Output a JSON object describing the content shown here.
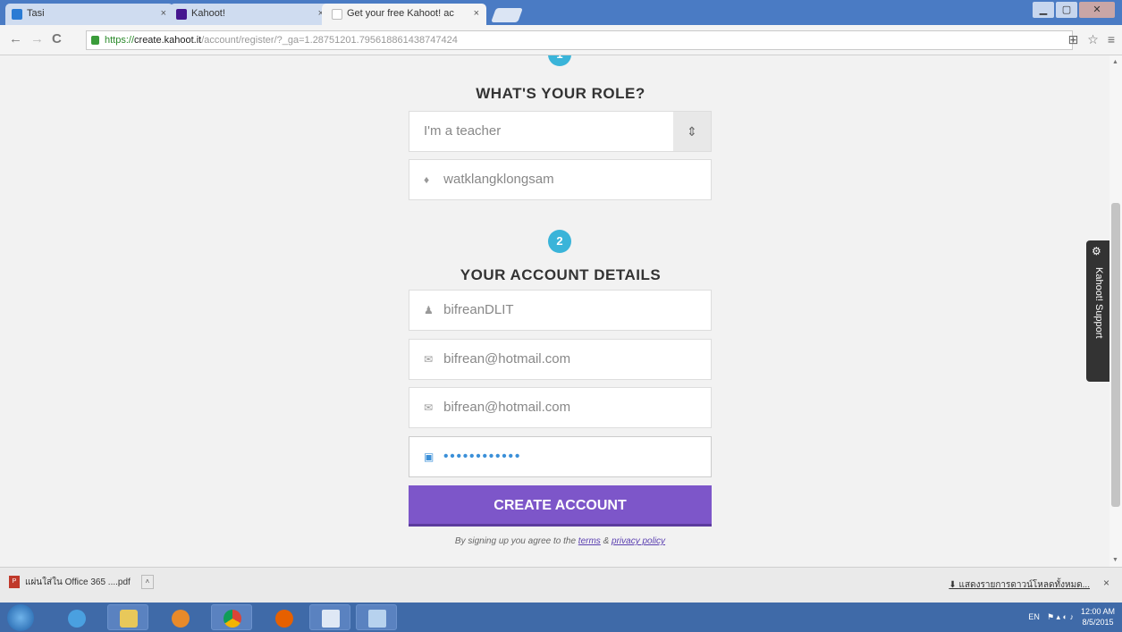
{
  "browser": {
    "tabs": [
      {
        "label": "Tasi",
        "fav_color": "#2a7bd4"
      },
      {
        "label": "Kahoot!",
        "fav_color": "#46178f"
      },
      {
        "label": "Get your free Kahoot! ac",
        "fav_color": "#ffffff"
      }
    ],
    "url_scheme": "https://",
    "url_host": "create.kahoot.it",
    "url_path": "/account/register/?_ga=1.28751201.795618861438747424"
  },
  "form": {
    "step1_number": "1",
    "role_heading": "WHAT'S YOUR ROLE?",
    "role_value": "I'm a teacher",
    "school_value": "watklangklongsam",
    "step2_number": "2",
    "account_heading": "YOUR ACCOUNT DETAILS",
    "username_value": "bifreanDLIT",
    "email_value": "bifrean@hotmail.com",
    "email_confirm_value": "bifrean@hotmail.com",
    "password_value": "••••••••••••",
    "create_label": "CREATE ACCOUNT",
    "terms_prefix": "By signing up you agree to the",
    "terms_link": "terms",
    "terms_amp": "&",
    "privacy_link": "privacy policy"
  },
  "support": {
    "label": "Kahoot! Support"
  },
  "downloads": {
    "file_label": "แผ่นใส่ใน Office 365 ....pdf",
    "show_all": "แสดงรายการดาวน์โหลดทั้งหมด..."
  },
  "taskbar": {
    "lang": "EN",
    "time": "12:00 AM",
    "date": "8/5/2015"
  },
  "colors": {
    "accent_purple": "#7d56c9",
    "step_blue": "#3ab4d9"
  }
}
